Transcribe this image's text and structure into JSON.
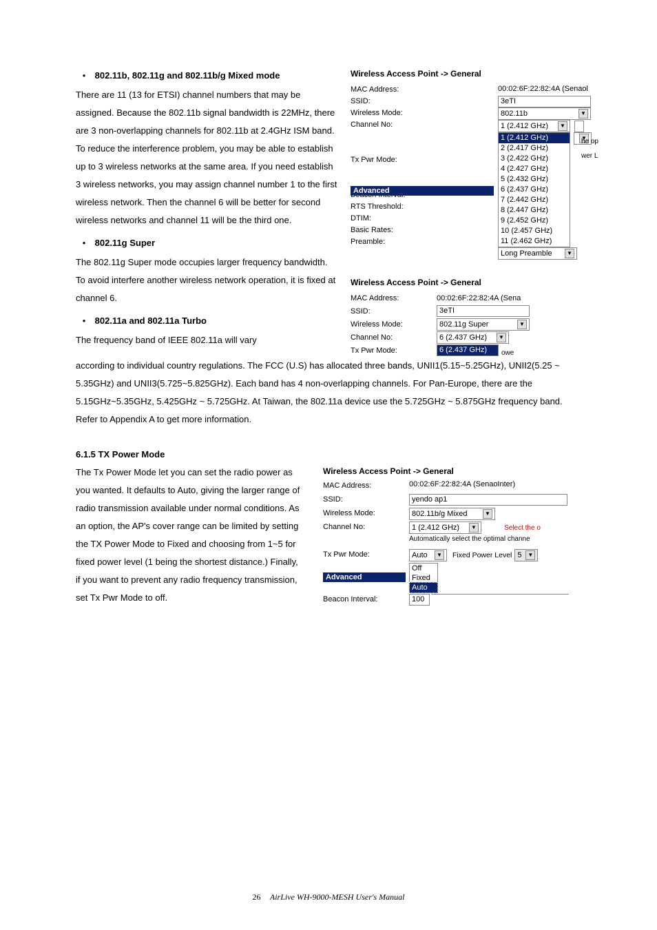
{
  "section1": {
    "bullet_title": "802.11b, 802.11g and 802.11b/g Mixed mode",
    "para": "There are 11 (13 for ETSI) channel numbers that may be assigned. Because the 802.11b signal bandwidth is 22MHz, there are 3 non-overlapping channels for 802.11b at 2.4GHz ISM band. To reduce the interference problem, you may be able to establish up to 3 wireless networks at the same area. If you need establish 3 wireless networks, you may assign channel number 1 to the first wireless network. Then the channel 6 will be better for second wireless networks and channel 11 will be the third one."
  },
  "section2": {
    "bullet_title": "802.11g Super",
    "para": "The 802.11g Super mode occupies larger frequency bandwidth. To avoid interfere another wireless network operation, it is fixed at channel 6."
  },
  "section3": {
    "bullet_title": "802.11a and 802.11a Turbo",
    "para_start": "The frequency band of IEEE 802.11a will vary",
    "para_full": "according to individual country regulations. The FCC (U.S) has allocated three bands, UNII1(5.15~5.25GHz), UNII2(5.25 ~ 5.35GHz) and UNII3(5.725~5.825GHz). Each band has 4 non-overlapping channels. For Pan-Europe, there are the 5.15GHz~5.35GHz, 5.425GHz ~ 5.725GHz. At Taiwan, the 802.11a device use the 5.725GHz ~ 5.875GHz frequency band. Refer to Appendix A to get more information."
  },
  "heading_615": "6.1.5 TX Power Mode",
  "section4": {
    "para": "The Tx Power Mode let you can set the radio power as you wanted. It defaults to Auto, giving the larger range of radio transmission available under normal conditions. As an option, the AP's cover range can be limited by setting the TX Power Mode to Fixed and choosing from 1~5 for fixed power level (1 being the shortest distance.) Finally, if you want to prevent any radio frequency transmission, set Tx Pwr Mode to off."
  },
  "fig1": {
    "title": "Wireless Access Point -> General",
    "labels": {
      "mac": "MAC Address:",
      "ssid": "SSID:",
      "wmode": "Wireless Mode:",
      "chno": "Channel No:",
      "txpwr": "Tx Pwr Mode:",
      "advanced": "Advanced",
      "beacon": "Beacon Interval:",
      "rts": "RTS Threshold:",
      "dtim": "DTIM:",
      "basic": "Basic Rates:",
      "preamble": "Preamble:"
    },
    "mac_value": "00:02:6F:22:82:4A (Senaol",
    "ssid_value": "3eTI",
    "wmode_value": "802.11b",
    "chno_value": "1 (2.412 GHz)",
    "channel_options": [
      "1 (2.412 GHz)",
      "2 (2.417 GHz)",
      "3 (2.422 GHz)",
      "4 (2.427 GHz)",
      "5 (2.432 GHz)",
      "6 (2.437 GHz)",
      "7 (2.442 GHz)",
      "8 (2.447 GHz)",
      "9 (2.452 GHz)",
      "10 (2.457 GHz)",
      "11 (2.462 GHz)"
    ],
    "preamble_value": "Long Preamble",
    "side_note1": "he op",
    "side_note2": "wer L"
  },
  "fig2": {
    "title": "Wireless Access Point -> General",
    "labels": {
      "mac": "MAC Address:",
      "ssid": "SSID:",
      "wmode": "Wireless Mode:",
      "chno": "Channel No:",
      "txpwr": "Tx Pwr Mode:"
    },
    "mac_value": "00:02:6F:22:82:4A (Sena",
    "ssid_value": "3eTI",
    "wmode_value": "802.11g Super",
    "chno_value": "6 (2.437 GHz)",
    "chno_highlight": "6 (2.437 GHz)",
    "side": "owe"
  },
  "fig3": {
    "title": "Wireless Access Point -> General",
    "labels": {
      "mac": "MAC Address:",
      "ssid": "SSID:",
      "wmode": "Wireless Mode:",
      "chno": "Channel No:",
      "txpwr": "Tx Pwr Mode:",
      "advanced": "Advanced",
      "beacon": "Beacon Interval:"
    },
    "mac_value": "00:02:6F:22:82:4A (SenaoInter)",
    "ssid_value": "yendo ap1",
    "wmode_value": "802.11b/g Mixed",
    "chno_value": "1 (2.412 GHz)",
    "chno_note": "Select the o",
    "auto_note": "Automatically select the optimal channe",
    "txpwr_value": "Auto",
    "fixed_label": "Fixed Power Level",
    "fixed_value": "5",
    "txpwr_options": [
      "Off",
      "Fixed",
      "Auto"
    ],
    "beacon_value": "100"
  },
  "footer": {
    "page": "26",
    "title": "AirLive WH-9000-MESH User's Manual"
  }
}
